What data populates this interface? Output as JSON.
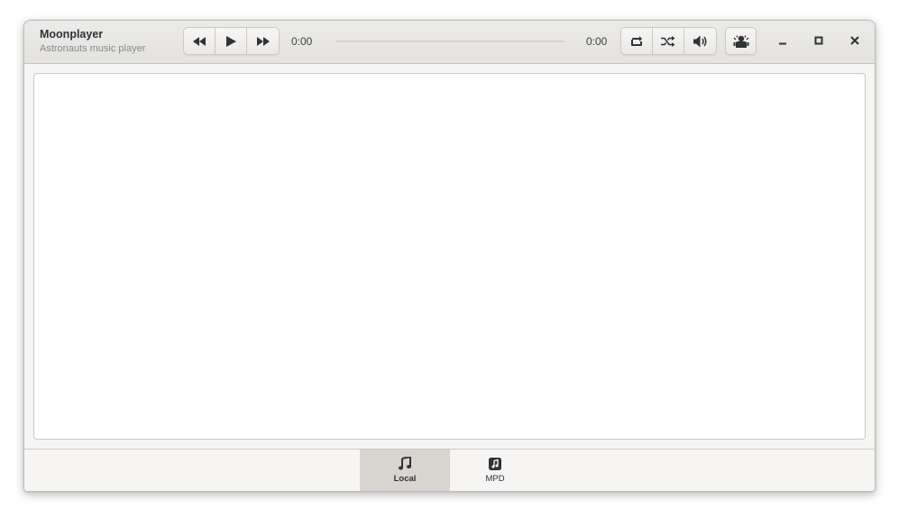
{
  "window": {
    "title": "Moonplayer",
    "subtitle": "Astronauts music player"
  },
  "player": {
    "prev_icon": "rewind-icon",
    "play_icon": "play-icon",
    "next_icon": "fast-forward-icon",
    "elapsed": "0:00",
    "duration": "0:00",
    "progress": 0
  },
  "toggles": {
    "repeat_icon": "repeat-icon",
    "shuffle_icon": "shuffle-icon",
    "volume_icon": "volume-icon"
  },
  "menu_icon": "astronaut-menu-icon",
  "window_controls": [
    "minimize-icon",
    "maximize-icon",
    "close-icon"
  ],
  "view_switcher": [
    {
      "label": "Local",
      "icon": "music-note-icon",
      "active": true
    },
    {
      "label": "MPD",
      "icon": "music-file-icon",
      "active": false
    }
  ],
  "colors": {
    "accent": "#3584e4",
    "active_tab": "#d8d4d0"
  }
}
